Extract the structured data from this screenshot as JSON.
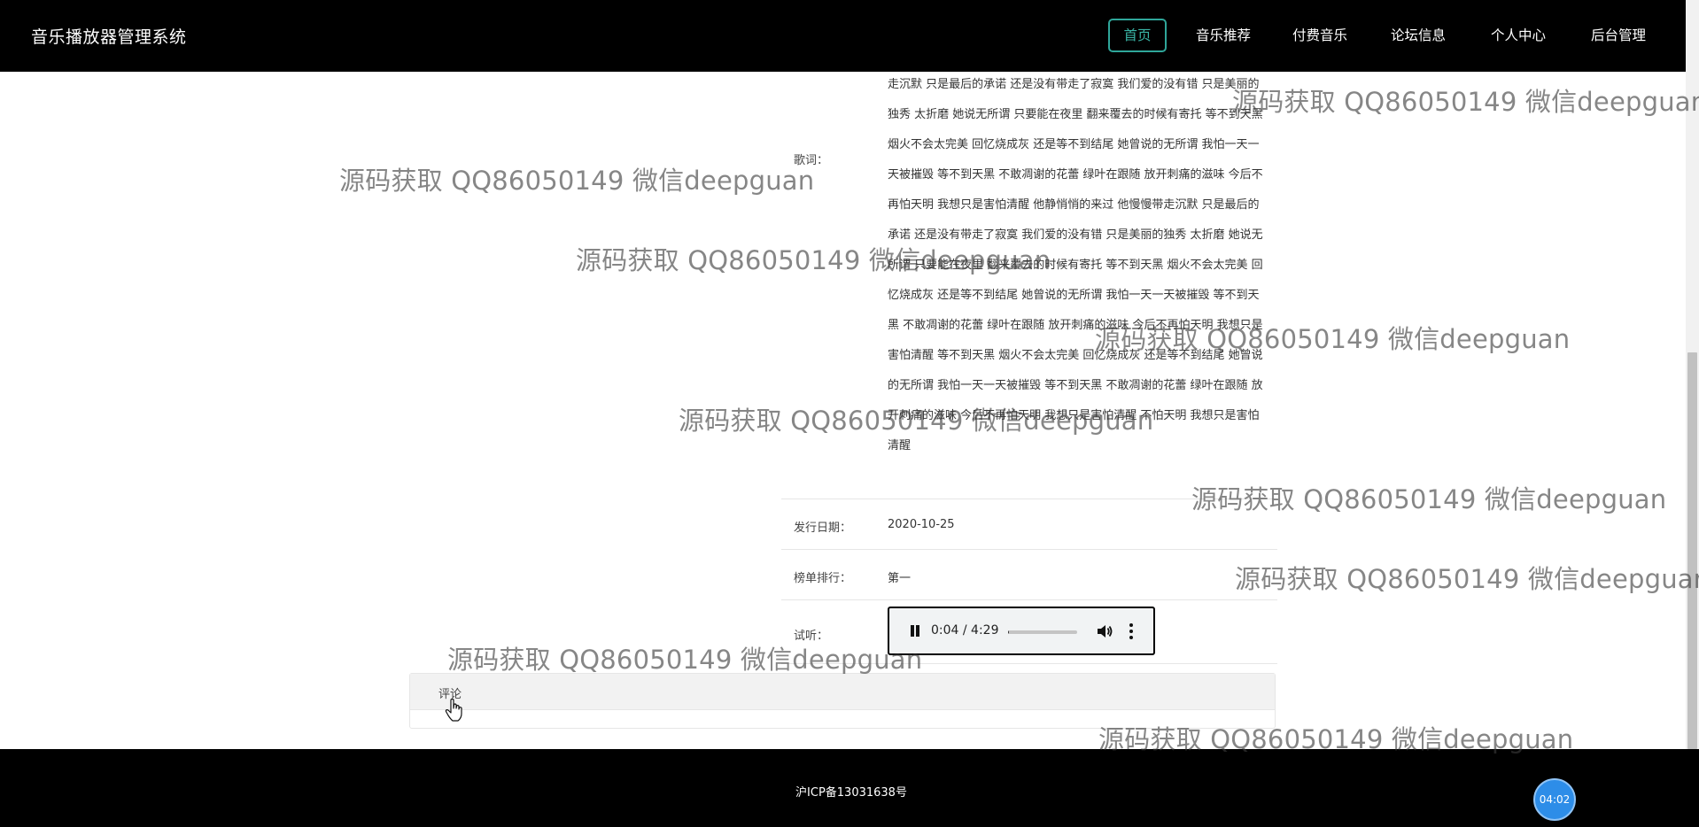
{
  "app": {
    "title": "音乐播放器管理系统"
  },
  "nav": {
    "items": [
      {
        "label": "首页",
        "active": true
      },
      {
        "label": "音乐推荐"
      },
      {
        "label": "付费音乐"
      },
      {
        "label": "论坛信息"
      },
      {
        "label": "个人中心"
      },
      {
        "label": "后台管理"
      }
    ]
  },
  "detail": {
    "lyrics_label": "歌词：",
    "lyrics": "走沉默 只是最后的承诺 还是没有带走了寂寞 我们爱的没有错 只是美丽的独秀 太折磨 她说无所谓 只要能在夜里 翻来覆去的时候有寄托 等不到天黑 烟火不会太完美 回忆烧成灰 还是等不到结尾 她曾说的无所谓 我怕一天一天被摧毁 等不到天黑 不敢凋谢的花蕾 绿叶在跟随 放开刺痛的滋味 今后不再怕天明 我想只是害怕清醒 他静悄悄的来过 他慢慢带走沉默 只是最后的承诺 还是没有带走了寂寞 我们爱的没有错 只是美丽的独秀 太折磨 她说无所谓 只要能在夜里 翻来覆去的时候有寄托 等不到天黑 烟火不会太完美 回忆烧成灰 还是等不到结尾 她曾说的无所谓 我怕一天一天被摧毁 等不到天黑 不敢凋谢的花蕾 绿叶在跟随 放开刺痛的滋味 今后不再怕天明 我想只是害怕清醒 等不到天黑 烟火不会太完美 回忆烧成灰 还是等不到结尾 她曾说的无所谓 我怕一天一天被摧毁 等不到天黑 不敢凋谢的花蕾 绿叶在跟随 放开刺痛的滋味 今后不再怕天明 我想只是害怕清醒 不怕天明 我想只是害怕清醒",
    "release_label": "发行日期：",
    "release_date": "2020-10-25",
    "rank_label": "榜单排行：",
    "rank_value": "第一",
    "preview_label": "试听："
  },
  "player": {
    "time": "0:04 / 4:29",
    "progress": 0.015,
    "icons": {
      "play_state": "pause-icon",
      "volume": "volume-icon",
      "menu": "more-vert-icon"
    }
  },
  "comments": {
    "title": "评论"
  },
  "footer": {
    "icp": "沪ICP备13031638号"
  },
  "clock": {
    "label": "04:02"
  },
  "watermark": {
    "text": "源码获取 QQ86050149 微信deepguan"
  },
  "colors": {
    "header_bg": "#000000",
    "active_nav_border": "#2fa69a",
    "clock_bg": "#2d8de8"
  }
}
